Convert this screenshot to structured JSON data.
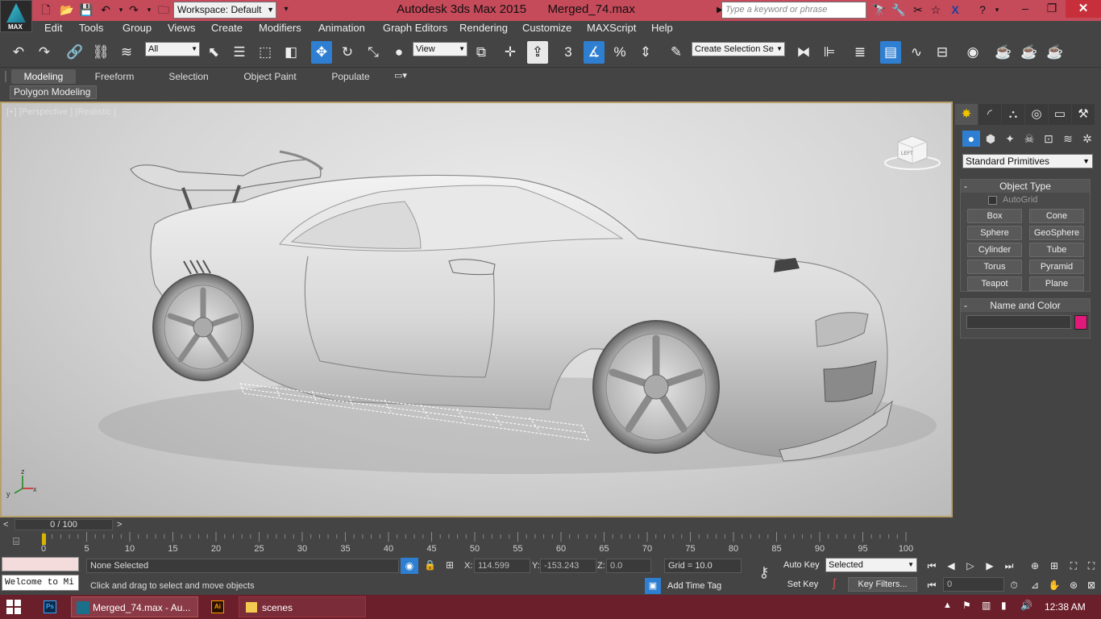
{
  "app": {
    "logo_text": "MAX",
    "title": "Autodesk 3ds Max  2015",
    "filename": "Merged_74.max",
    "workspace": "Workspace: Default",
    "search_placeholder": "Type a keyword or phrase"
  },
  "menu": [
    "Edit",
    "Tools",
    "Group",
    "Views",
    "Create",
    "Modifiers",
    "Animation",
    "Graph Editors",
    "Rendering",
    "Customize",
    "MAXScript",
    "Help"
  ],
  "toolbar": {
    "selection_filter": "All",
    "ref_coord": "View",
    "named_selection": "Create Selection Se",
    "snap_label": "3",
    "active_tool": "select-and-move"
  },
  "ribbon": {
    "tabs": [
      "Modeling",
      "Freeform",
      "Selection",
      "Object Paint",
      "Populate"
    ],
    "active_tab": "Modeling",
    "panel_label": "Polygon Modeling"
  },
  "viewport": {
    "label": "[+] [Perspective ] [Realistic ]",
    "viewcube_face": "LEFT",
    "axis_labels": [
      "x",
      "y",
      "z"
    ]
  },
  "command_panel": {
    "dropdown": "Standard Primitives",
    "object_type_title": "Object Type",
    "autogrid_label": "AutoGrid",
    "buttons": [
      "Box",
      "Cone",
      "Sphere",
      "GeoSphere",
      "Cylinder",
      "Tube",
      "Torus",
      "Pyramid",
      "Teapot",
      "Plane"
    ],
    "name_color_title": "Name and Color",
    "object_color": "#e0197b"
  },
  "timeline": {
    "slider_text": "0 / 100",
    "ticks": [
      "0",
      "5",
      "10",
      "15",
      "20",
      "25",
      "30",
      "35",
      "40",
      "45",
      "50",
      "55",
      "60",
      "65",
      "70",
      "75",
      "80",
      "85",
      "90",
      "95",
      "100"
    ]
  },
  "status": {
    "selection": "None Selected",
    "prompt": "Click and drag to select and move objects",
    "maxscript_listener": "Welcome to Mi",
    "x_label": "X:",
    "x_value": "114.599",
    "y_label": "Y:",
    "y_value": "-153.243",
    "z_label": "Z:",
    "z_value": "0.0",
    "grid": "Grid = 10.0",
    "add_time_tag": "Add Time Tag",
    "auto_key": "Auto Key",
    "set_key": "Set Key",
    "key_mode": "Selected",
    "key_filters": "Key Filters...",
    "current_frame": "0"
  },
  "taskbar": {
    "items": [
      {
        "label": "",
        "icon": "photoshop-icon"
      },
      {
        "label": "Merged_74.max - Au...",
        "icon": "3dsmax-icon"
      },
      {
        "label": "",
        "icon": "illustrator-icon"
      },
      {
        "label": "scenes",
        "icon": "folder-icon"
      }
    ],
    "clock": "12:38 AM"
  },
  "colors": {
    "titlebar": "#c54a5a",
    "accent_blue": "#2e7fd1",
    "taskbar": "#6b1f2a",
    "viewport_border": "#b8a06a"
  }
}
